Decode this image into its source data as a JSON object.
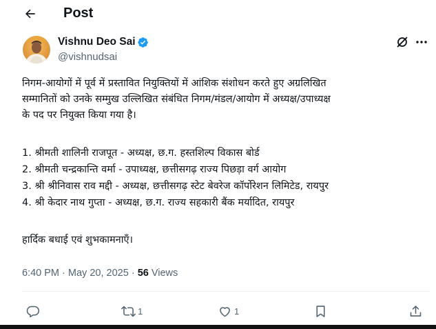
{
  "header": {
    "title": "Post",
    "back_icon": "arrow-left-icon"
  },
  "author": {
    "name": "Vishnu Deo Sai",
    "handle": "@vishnudsai",
    "verified": true,
    "verified_color": "#1d9bf0"
  },
  "post": {
    "text_lines": [
      "निगम-आयोगों में पूर्व में प्रस्तावित नियुक्तियों में आंशिक संशोधन करते हुए अग्रलिखित",
      "सम्मानितों को उनके सम्मुख उल्लिखित संबंधित निगम/मंडल/आयोग में अध्यक्ष/उपाध्यक्ष",
      "के पद पर नियुक्त किया गया है।"
    ],
    "list": [
      "1. श्रीमती शालिनी राजपूत - अध्यक्ष, छ.ग. हस्तशिल्प विकास बोर्ड",
      "2. श्रीमती चन्द्रकान्ति वर्मा - उपाध्यक्ष,  छत्तीसगढ़ राज्य पिछड़ा वर्ग आयोग",
      "3. श्री श्रीनिवास राव मद्दी - अध्यक्ष, छत्तीसगढ़ स्टेट बेवरेज कॉर्पोरेशन लिमिटेड, रायपुर",
      "4. श्री केदार नाथ गुप्ता - अध्यक्ष,  छ.ग. राज्य सहकारी बैंक मर्यादित, रायपुर"
    ],
    "closing": "हार्दिक बधाई एवं शुभकामनाएँ।"
  },
  "meta": {
    "time": "6:40 PM",
    "separator": "·",
    "date": "May 20, 2025",
    "views_count": "56",
    "views_label": "Views"
  },
  "actions": {
    "reply_icon": "comment-icon",
    "repost_icon": "repost-icon",
    "repost_count": "1",
    "like_icon": "heart-icon",
    "like_count": "1",
    "bookmark_icon": "bookmark-icon",
    "share_icon": "share-icon"
  },
  "colors": {
    "text": "#0f1419",
    "secondary": "#536471",
    "accent": "#1d9bf0"
  }
}
